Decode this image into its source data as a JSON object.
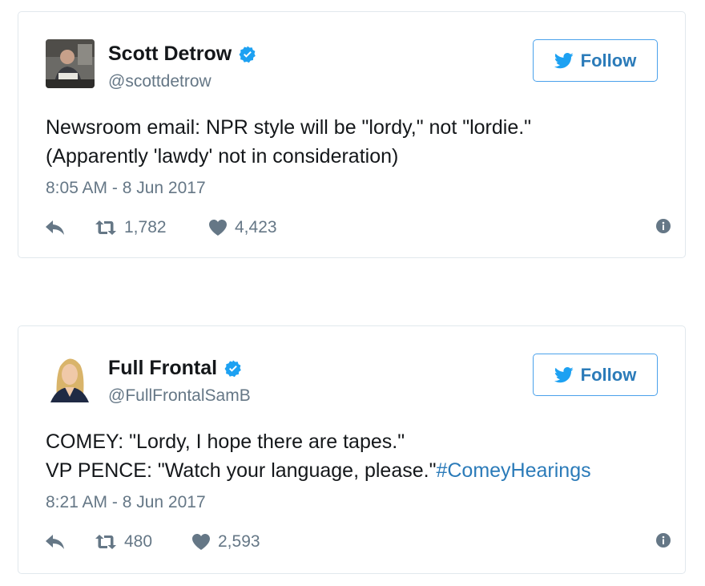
{
  "tweets": [
    {
      "name": "Scott Detrow",
      "handle": "@scottdetrow",
      "follow_label": "Follow",
      "text_lines": [
        "Newsroom email: NPR style will be \"lordy,\" not \"lordie.\"",
        "(Apparently 'lawdy' not in consideration)"
      ],
      "timestamp": "8:05 AM - 8 Jun 2017",
      "retweets": "1,782",
      "likes": "4,423"
    },
    {
      "name": "Full Frontal",
      "handle": "@FullFrontalSamB",
      "follow_label": "Follow",
      "text_lines": [
        "COMEY: \"Lordy, I hope there are tapes.\"",
        "VP PENCE: \"Watch your language, please.\""
      ],
      "hashtag": "#ComeyHearings",
      "timestamp": "8:21 AM - 8 Jun 2017",
      "retweets": "480",
      "likes": "2,593"
    }
  ],
  "colors": {
    "accent": "#2b7bb9",
    "verified": "#1da1f2",
    "muted": "#657786",
    "border": "#e1e8ed"
  },
  "icons": [
    "verified-badge-icon",
    "twitter-bird-icon",
    "reply-icon",
    "retweet-icon",
    "heart-icon",
    "info-icon"
  ]
}
